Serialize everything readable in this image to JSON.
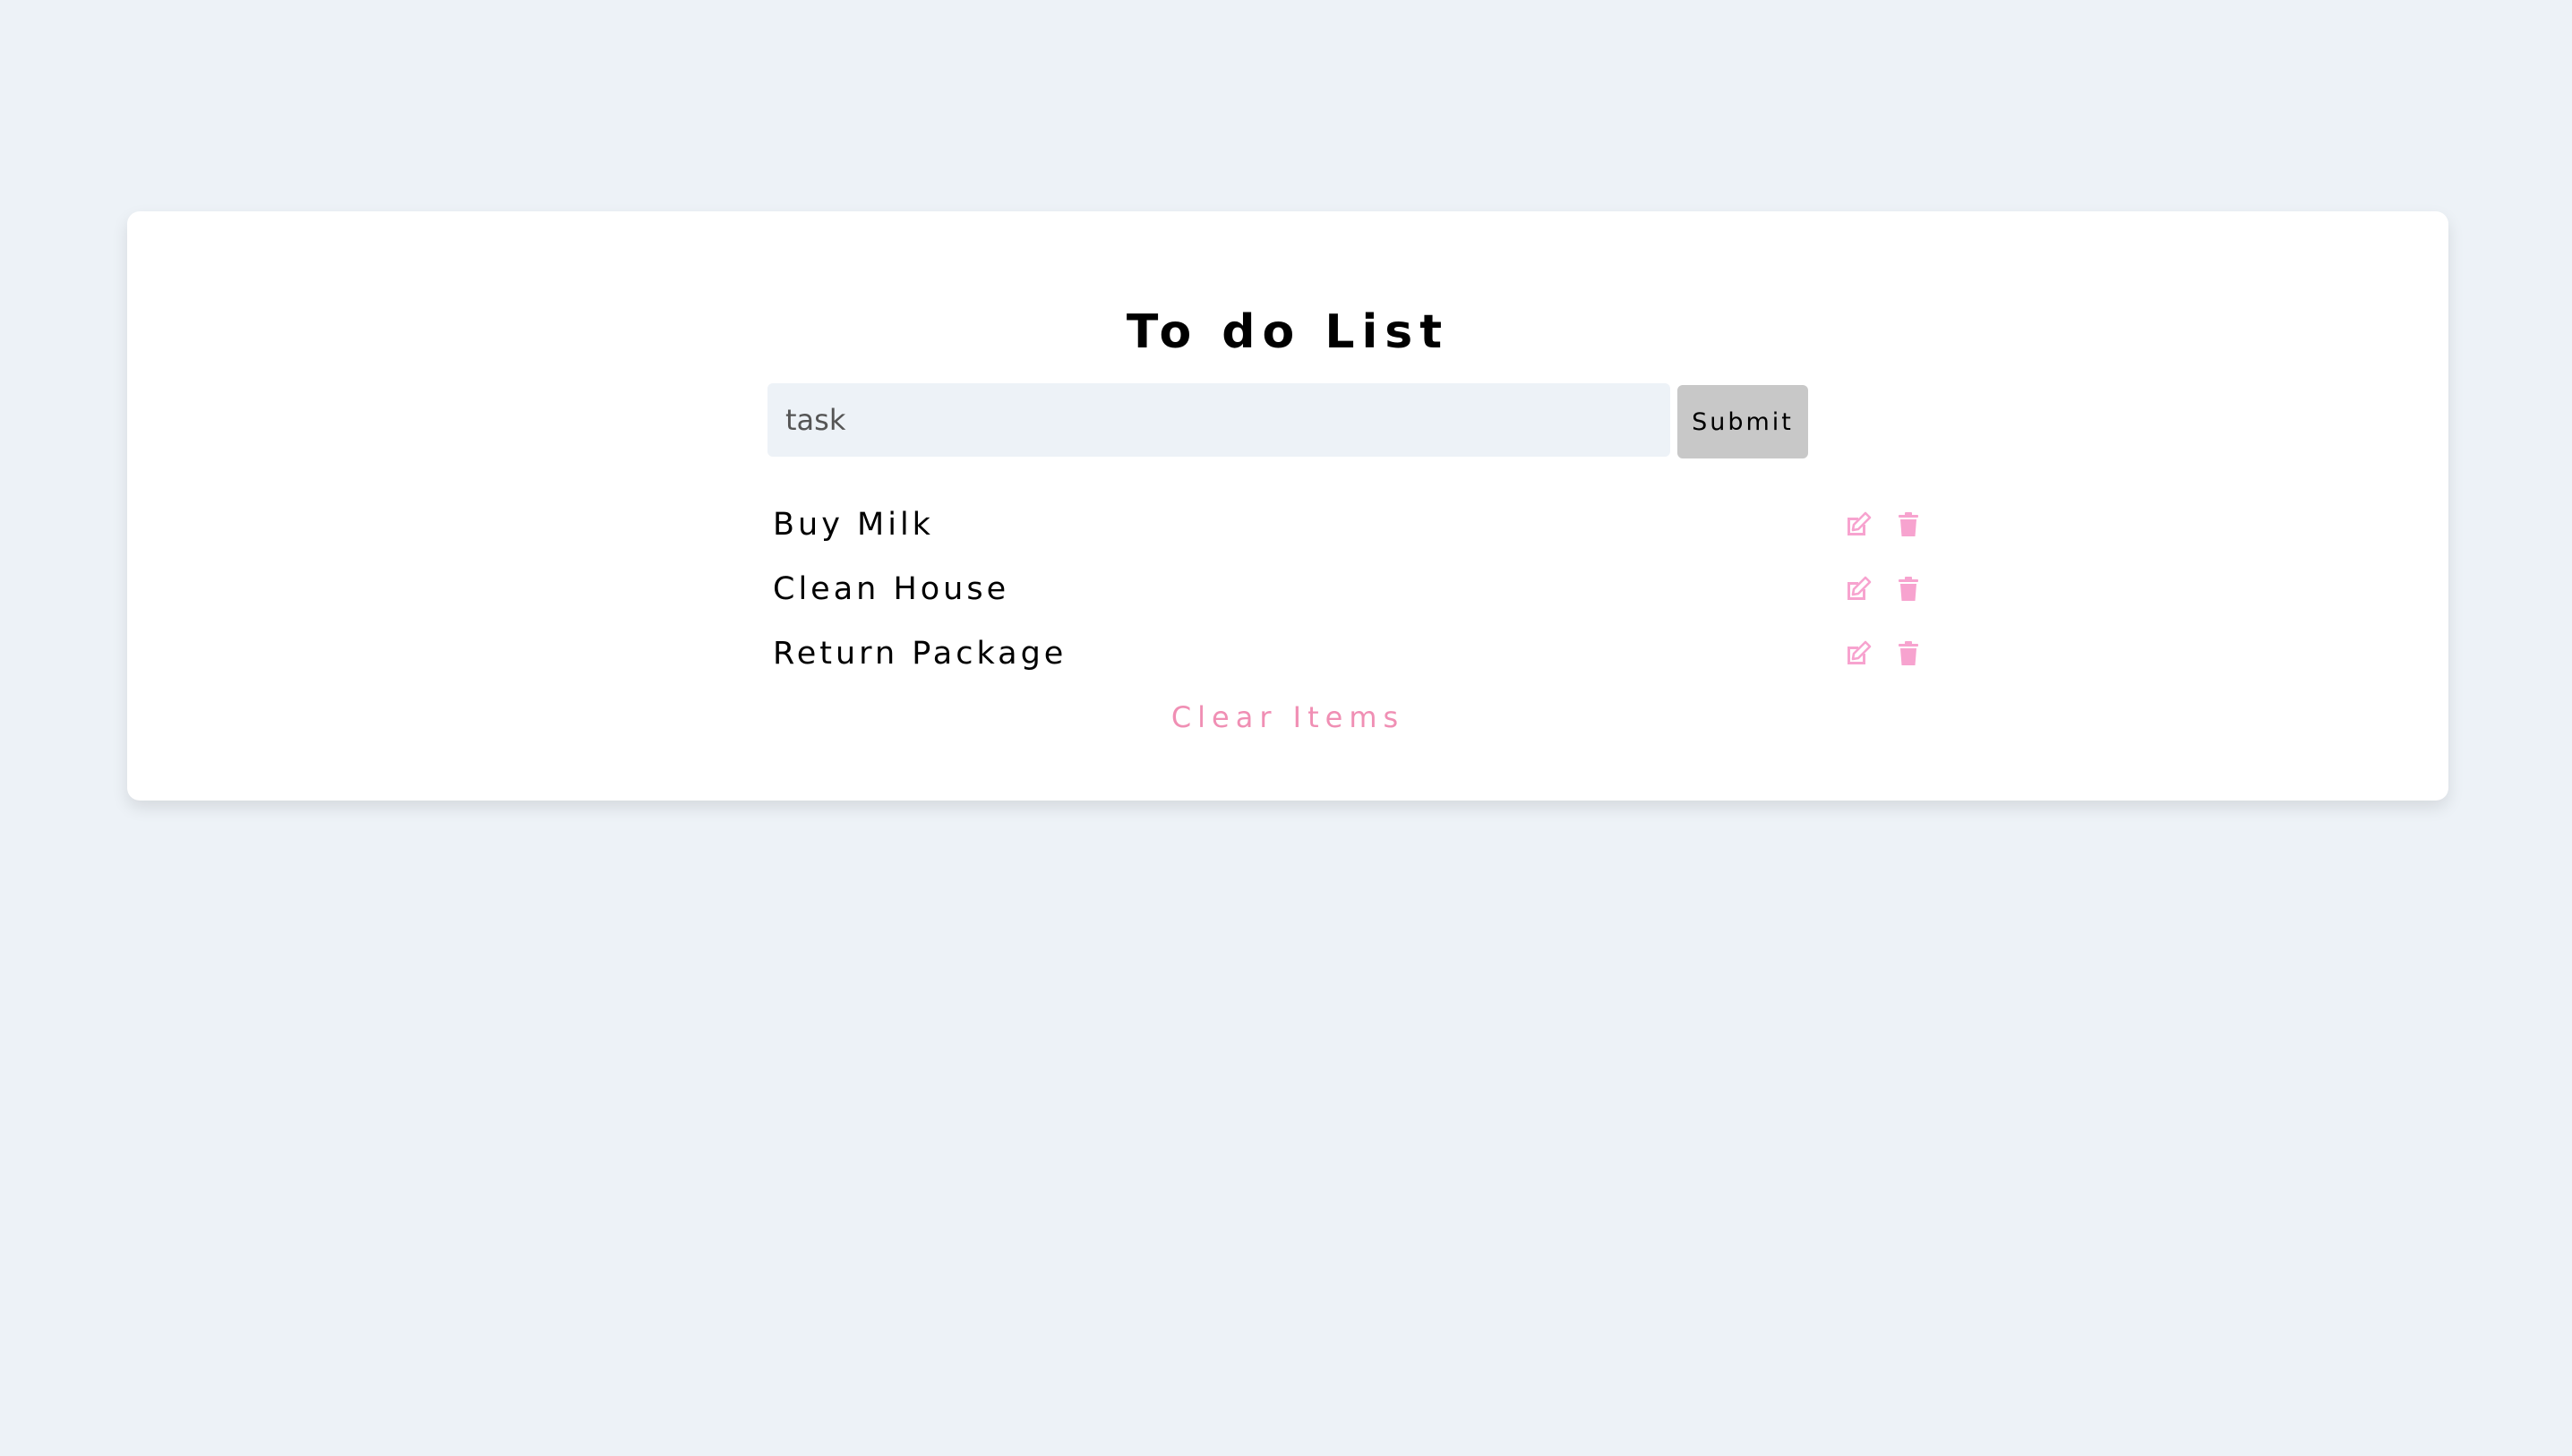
{
  "app": {
    "title": "To do List"
  },
  "form": {
    "input_placeholder": "task",
    "input_value": "",
    "submit_label": "Submit"
  },
  "items": [
    {
      "label": "Buy Milk"
    },
    {
      "label": "Clean House"
    },
    {
      "label": "Return Package"
    }
  ],
  "clear_label": "Clear Items",
  "icons": {
    "edit": "edit-icon",
    "delete": "trash-icon"
  },
  "colors": {
    "background": "#edf2f7",
    "card": "#ffffff",
    "accent": "#f7a3cf",
    "clear_text": "#f08fb4",
    "submit_bg": "#c8c8c8"
  }
}
